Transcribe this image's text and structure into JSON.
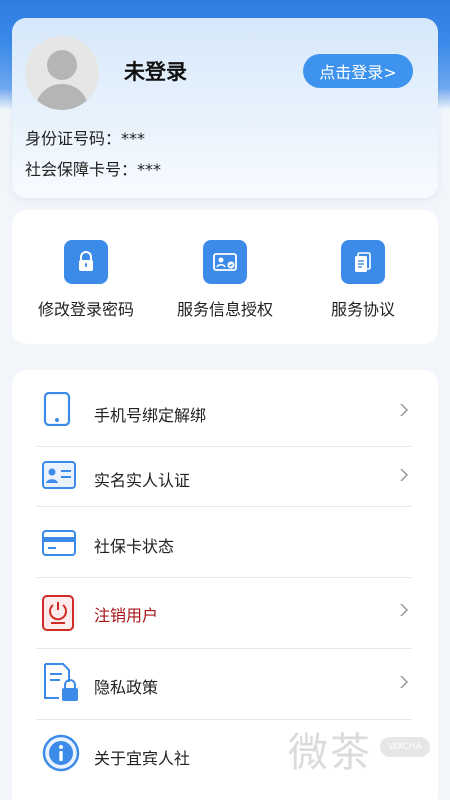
{
  "profile": {
    "username": "未登录",
    "login_button": "点击登录>",
    "id_card": "身份证号码：***",
    "social_card": "社会保障卡号：***"
  },
  "actions": [
    {
      "label": "修改登录密码",
      "icon": "lock-icon"
    },
    {
      "label": "服务信息授权",
      "icon": "id-card-check-icon"
    },
    {
      "label": "服务协议",
      "icon": "document-icon"
    }
  ],
  "menu": [
    {
      "label": "手机号绑定解绑",
      "icon": "phone-icon",
      "chevron": true
    },
    {
      "label": "实名实人认证",
      "icon": "id-card-icon",
      "chevron": true
    },
    {
      "label": "社保卡状态",
      "icon": "card-icon",
      "chevron": false
    },
    {
      "label": "注销用户",
      "icon": "power-off-icon",
      "chevron": true,
      "color": "#a8141a"
    },
    {
      "label": "隐私政策",
      "icon": "privacy-lock-doc-icon",
      "chevron": true
    },
    {
      "label": "关于宜宾人社",
      "icon": "info-icon",
      "chevron": false
    }
  ],
  "watermark": {
    "text": "微茶",
    "badge": "WXCHA"
  },
  "colors": {
    "primary": "#3e93ee",
    "danger": "#a8141a",
    "background": "#f2f5fa"
  }
}
